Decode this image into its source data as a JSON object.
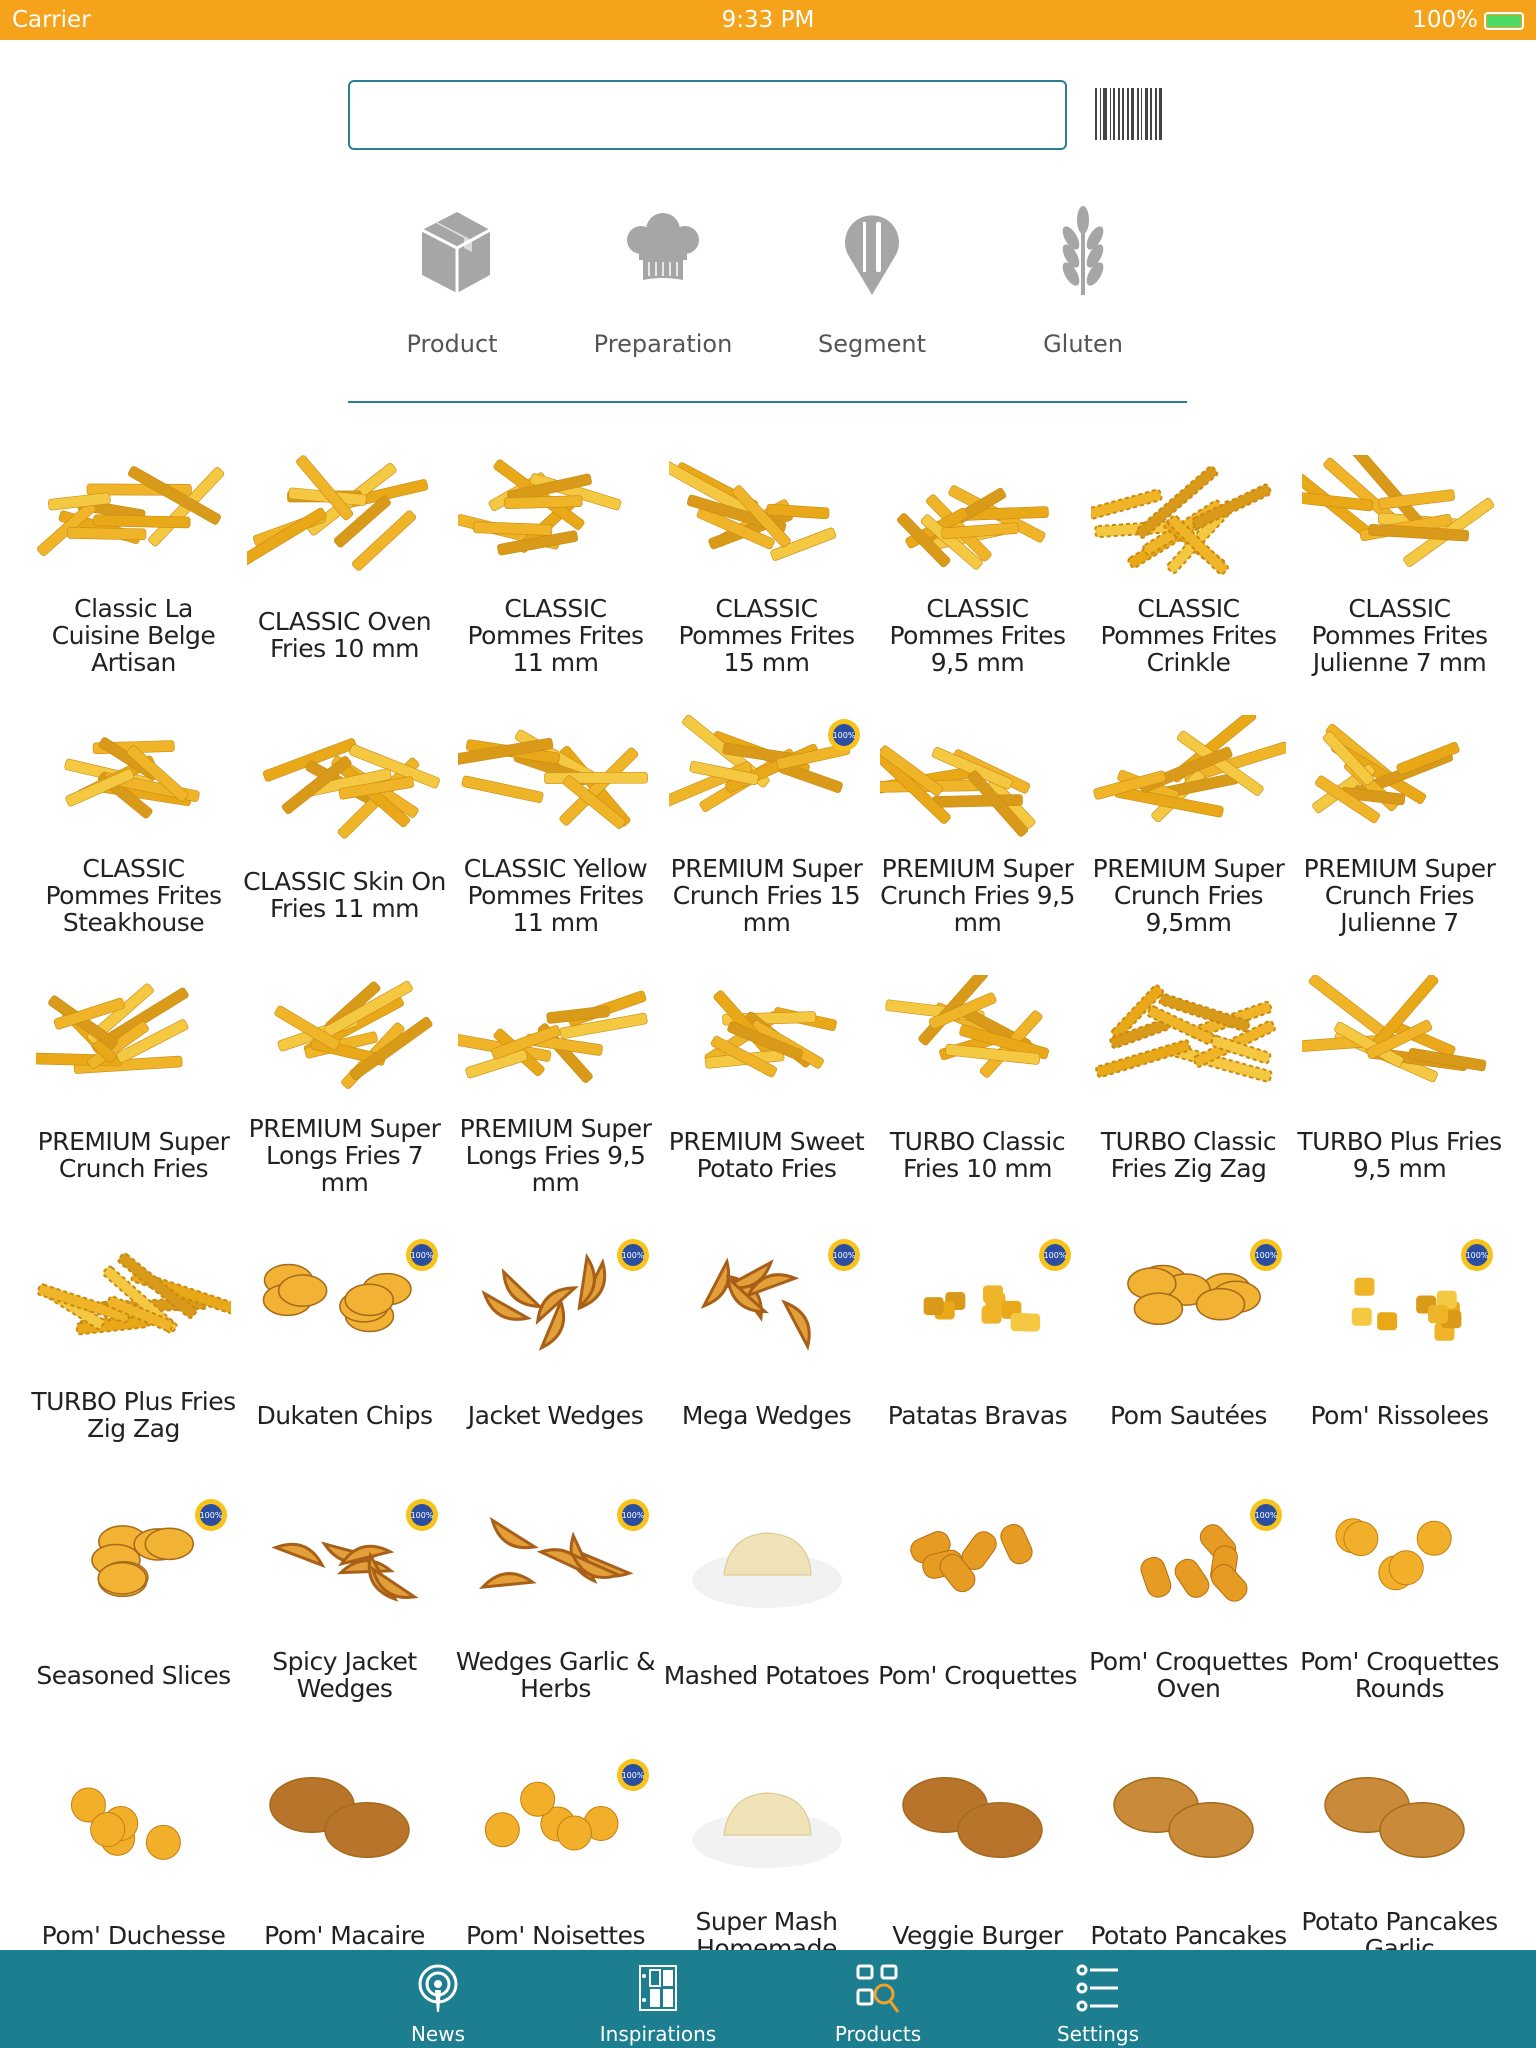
{
  "status_bar": {
    "carrier": "Carrier",
    "time": "9:33 PM",
    "battery": "100%",
    "battery_level": 100
  },
  "search": {
    "value": "",
    "placeholder": ""
  },
  "barcode_icon": "barcode-icon",
  "categories": [
    {
      "label": "Product",
      "icon": "box-icon"
    },
    {
      "label": "Preparation",
      "icon": "chef-hat-icon"
    },
    {
      "label": "Segment",
      "icon": "fork-knife-pin-icon"
    },
    {
      "label": "Gluten",
      "icon": "wheat-icon"
    }
  ],
  "colors": {
    "status_bar": "#f5a31a",
    "accent": "#1d7e8f",
    "icon_gray": "#a6a6a6",
    "product_highlight": "#e8a817"
  },
  "products": [
    {
      "name": "Classic La Cuisine Belge Artisan",
      "shape": "fries",
      "badge": false
    },
    {
      "name": "CLASSIC Oven Fries 10 mm",
      "shape": "fries",
      "badge": false
    },
    {
      "name": "CLASSIC Pommes Frites 11 mm",
      "shape": "fries",
      "badge": false
    },
    {
      "name": "CLASSIC Pommes Frites 15 mm",
      "shape": "fries",
      "badge": false
    },
    {
      "name": "CLASSIC Pommes Frites 9,5 mm",
      "shape": "fries",
      "badge": false
    },
    {
      "name": "CLASSIC Pommes Frites Crinkle",
      "shape": "crinkle",
      "badge": false
    },
    {
      "name": "CLASSIC Pommes Frites Julienne 7 mm",
      "shape": "fries",
      "badge": false
    },
    {
      "name": "CLASSIC Pommes Frites Steakhouse",
      "shape": "fries",
      "badge": false
    },
    {
      "name": "CLASSIC Skin On Fries 11 mm",
      "shape": "fries",
      "badge": false
    },
    {
      "name": "CLASSIC Yellow Pommes Frites 11 mm",
      "shape": "fries",
      "badge": false
    },
    {
      "name": "PREMIUM Super Crunch Fries 15 mm",
      "shape": "fries",
      "badge": true
    },
    {
      "name": "PREMIUM Super Crunch Fries 9,5 mm",
      "shape": "fries",
      "badge": false
    },
    {
      "name": "PREMIUM Super Crunch Fries 9,5mm",
      "shape": "fries",
      "badge": false
    },
    {
      "name": "PREMIUM Super Crunch Fries Julienne 7",
      "shape": "fries",
      "badge": false
    },
    {
      "name": "PREMIUM Super Crunch Fries",
      "shape": "fries",
      "badge": false
    },
    {
      "name": "PREMIUM Super Longs Fries 7 mm",
      "shape": "fries",
      "badge": false
    },
    {
      "name": "PREMIUM Super Longs Fries 9,5 mm",
      "shape": "fries",
      "badge": false
    },
    {
      "name": "PREMIUM Sweet Potato Fries",
      "shape": "fries",
      "badge": false
    },
    {
      "name": "TURBO Classic Fries 10 mm",
      "shape": "fries",
      "badge": false
    },
    {
      "name": "TURBO Classic Fries Zig Zag",
      "shape": "crinkle",
      "badge": false
    },
    {
      "name": "TURBO Plus Fries 9,5 mm",
      "shape": "fries",
      "badge": false
    },
    {
      "name": "TURBO Plus Fries Zig Zag",
      "shape": "crinkle",
      "badge": false
    },
    {
      "name": "Dukaten Chips",
      "shape": "slices",
      "badge": true
    },
    {
      "name": "Jacket Wedges",
      "shape": "wedges",
      "badge": true
    },
    {
      "name": "Mega Wedges",
      "shape": "wedges",
      "badge": true
    },
    {
      "name": "Patatas Bravas",
      "shape": "cubes",
      "badge": true
    },
    {
      "name": "Pom Sautées",
      "shape": "slices",
      "badge": true
    },
    {
      "name": "Pom' Rissolees",
      "shape": "cubes",
      "badge": true
    },
    {
      "name": "Seasoned Slices",
      "shape": "slices",
      "badge": true
    },
    {
      "name": "Spicy Jacket Wedges",
      "shape": "wedges",
      "badge": true
    },
    {
      "name": "Wedges Garlic & Herbs",
      "shape": "wedges",
      "badge": true
    },
    {
      "name": "Mashed Potatoes",
      "shape": "mash",
      "badge": false
    },
    {
      "name": "Pom' Croquettes",
      "shape": "croquettes",
      "badge": false
    },
    {
      "name": "Pom' Croquettes Oven",
      "shape": "croquettes",
      "badge": true
    },
    {
      "name": "Pom' Croquettes Rounds",
      "shape": "balls",
      "badge": false
    },
    {
      "name": "Pom' Duchesse",
      "shape": "balls",
      "badge": false
    },
    {
      "name": "Pom' Macaire",
      "shape": "patty",
      "badge": false
    },
    {
      "name": "Pom' Noisettes",
      "shape": "balls",
      "badge": true
    },
    {
      "name": "Super Mash Homemade",
      "shape": "mash",
      "badge": false
    },
    {
      "name": "Veggie Burger",
      "shape": "patty",
      "badge": false
    },
    {
      "name": "Potato Pancakes",
      "shape": "pancake",
      "badge": false
    },
    {
      "name": "Potato Pancakes Garlic",
      "shape": "pancake",
      "badge": false
    }
  ],
  "tabs": [
    {
      "label": "News",
      "icon": "podcast-icon",
      "active": false
    },
    {
      "label": "Inspirations",
      "icon": "layout-icon",
      "active": false
    },
    {
      "label": "Products",
      "icon": "product-search-icon",
      "active": true
    },
    {
      "label": "Settings",
      "icon": "checklist-icon",
      "active": false
    }
  ]
}
